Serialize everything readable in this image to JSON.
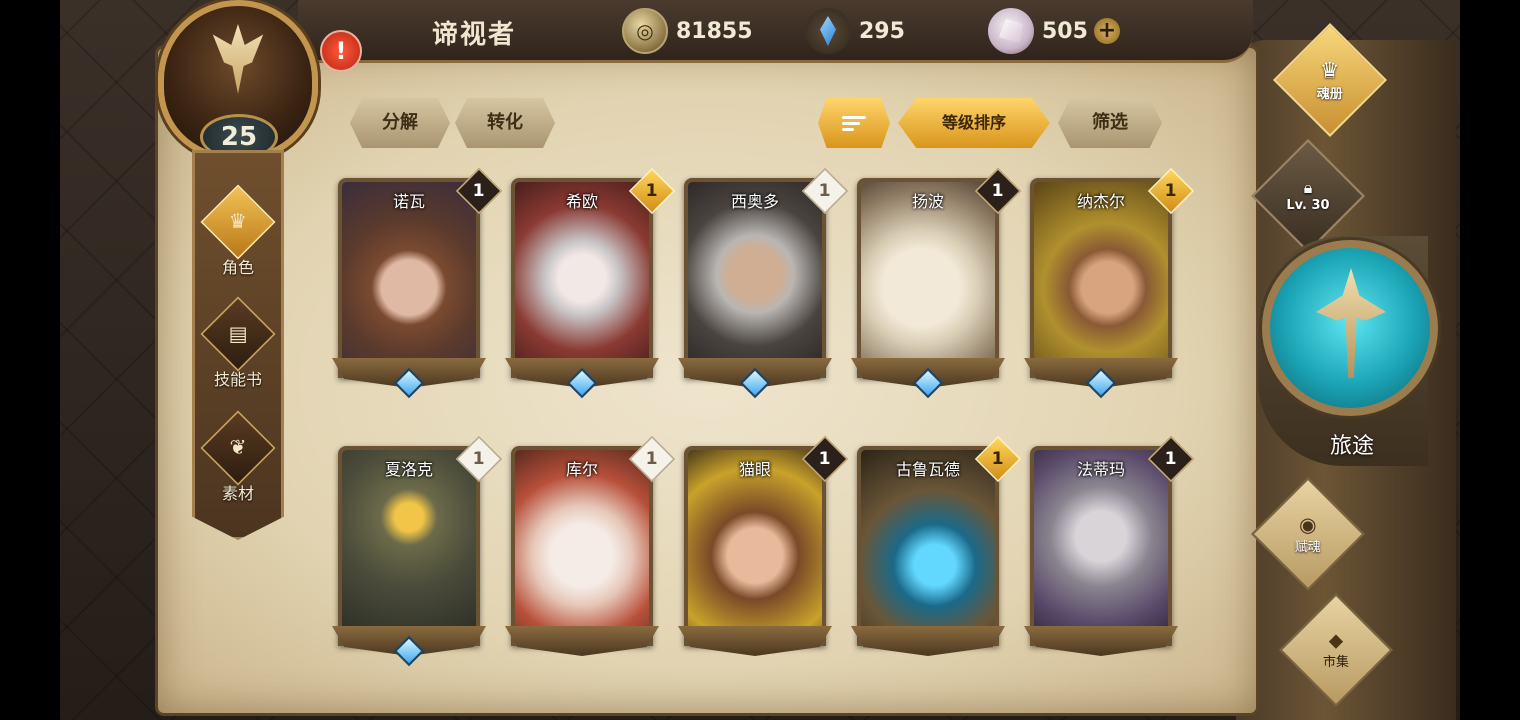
{
  "header": {
    "player_name": "谛视者",
    "level": "25",
    "alert": "!",
    "currencies": [
      {
        "icon": "gold-coin-icon",
        "value": "81855"
      },
      {
        "icon": "blue-crystal-icon",
        "value": "295"
      },
      {
        "icon": "soul-gem-icon",
        "value": "505"
      }
    ],
    "add_label": "+"
  },
  "left_nav": [
    {
      "label": "角色",
      "icon": "helmet-icon",
      "active": true
    },
    {
      "label": "技能书",
      "icon": "skill-book-icon",
      "active": false
    },
    {
      "label": "素材",
      "icon": "material-icon",
      "active": false
    }
  ],
  "toolbar": {
    "decompose": "分解",
    "convert": "转化",
    "sort_by_level": "等级排序",
    "filter": "筛选"
  },
  "characters": [
    {
      "name": "诺瓦",
      "stars": "1",
      "badge": "dark"
    },
    {
      "name": "希欧",
      "stars": "1",
      "badge": "gold"
    },
    {
      "name": "西奥多",
      "stars": "1",
      "badge": "white"
    },
    {
      "name": "扬波",
      "stars": "1",
      "badge": "dark"
    },
    {
      "name": "纳杰尔",
      "stars": "1",
      "badge": "gold"
    },
    {
      "name": "夏洛克",
      "stars": "1",
      "badge": "white"
    },
    {
      "name": "库尔",
      "stars": "1",
      "badge": "white"
    },
    {
      "name": "猫眼",
      "stars": "1",
      "badge": "dark"
    },
    {
      "name": "古鲁瓦德",
      "stars": "1",
      "badge": "gold"
    },
    {
      "name": "法蒂玛",
      "stars": "1",
      "badge": "dark"
    }
  ],
  "right_menu": {
    "soul_book": "魂册",
    "locked_level": "Lv. 30",
    "journey": "旅途",
    "endow_soul": "赋魂",
    "market": "市集"
  }
}
